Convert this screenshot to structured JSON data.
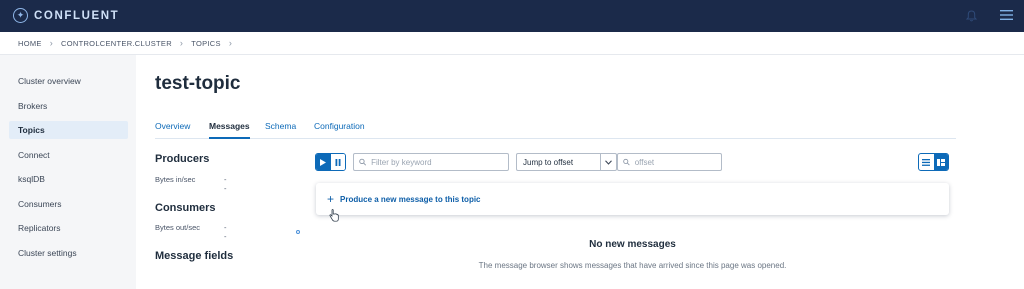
{
  "app": {
    "brand": "CONFLUENT"
  },
  "breadcrumb": [
    "HOME",
    "CONTROLCENTER.CLUSTER",
    "TOPICS"
  ],
  "sidebar": {
    "items": [
      {
        "label": "Cluster overview"
      },
      {
        "label": "Brokers"
      },
      {
        "label": "Topics",
        "active": true
      },
      {
        "label": "Connect"
      },
      {
        "label": "ksqlDB"
      },
      {
        "label": "Consumers"
      },
      {
        "label": "Replicators"
      },
      {
        "label": "Cluster settings"
      }
    ]
  },
  "page": {
    "title": "test-topic"
  },
  "tabs": [
    {
      "label": "Overview"
    },
    {
      "label": "Messages",
      "active": true
    },
    {
      "label": "Schema"
    },
    {
      "label": "Configuration"
    }
  ],
  "producers": {
    "heading": "Producers",
    "metric_label": "Bytes in/sec",
    "metric_value": "--"
  },
  "consumers": {
    "heading": "Consumers",
    "metric_label": "Bytes out/sec",
    "metric_value": "--"
  },
  "message_fields": {
    "heading": "Message fields"
  },
  "toolbar": {
    "filter_placeholder": "Filter by keyword",
    "jump_select_value": "Jump to offset",
    "offset_placeholder": "offset"
  },
  "produce": {
    "label": "Produce a new message to this topic"
  },
  "empty_state": {
    "heading": "No new messages",
    "description": "The message browser shows messages that have arrived since this page was opened."
  },
  "colors": {
    "accent": "#0d6ab8",
    "topbar": "#1b2a4a",
    "sidebar_bg": "#f5f6f8",
    "active_item_bg": "#e3edf8"
  }
}
